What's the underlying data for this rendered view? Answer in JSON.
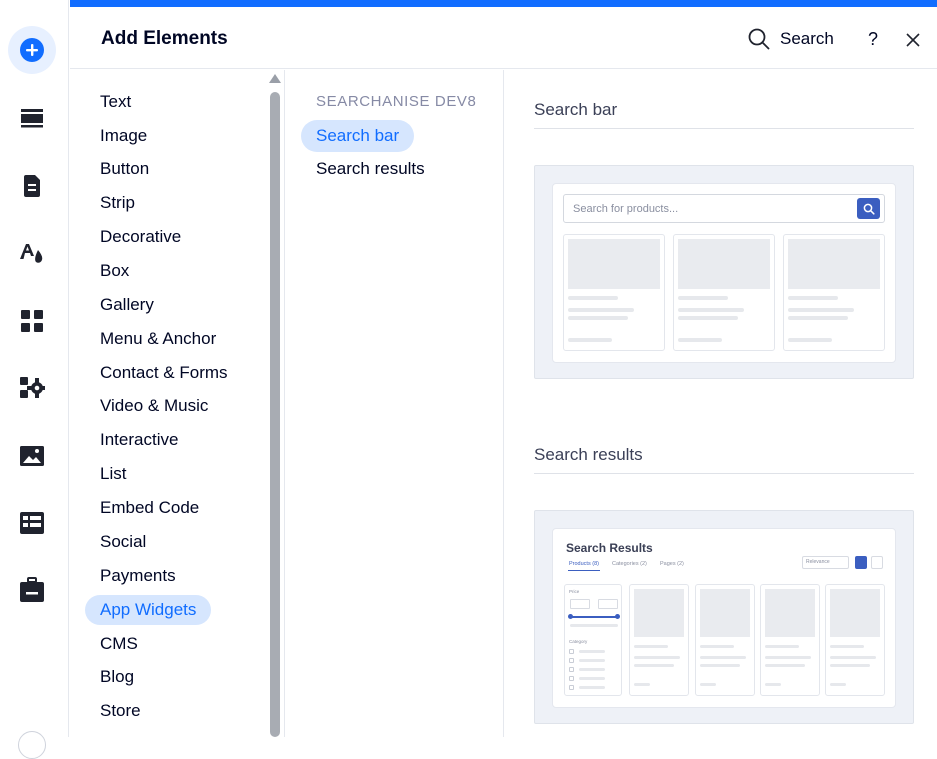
{
  "rail": {
    "items": [
      {
        "name": "add-elements-icon",
        "active": true
      },
      {
        "name": "sections-icon",
        "active": false
      },
      {
        "name": "pages-icon",
        "active": false
      },
      {
        "name": "theme-design-icon",
        "active": false
      },
      {
        "name": "app-market-icon",
        "active": false
      },
      {
        "name": "business-apps-icon",
        "active": false
      },
      {
        "name": "media-icon",
        "active": false
      },
      {
        "name": "cms-table-icon",
        "active": false
      },
      {
        "name": "portfolio-briefcase-icon",
        "active": false
      }
    ]
  },
  "header": {
    "title": "Add Elements",
    "search_label": "Search",
    "help_label": "?"
  },
  "categories": {
    "items": [
      "Text",
      "Image",
      "Button",
      "Strip",
      "Decorative",
      "Box",
      "Gallery",
      "Menu & Anchor",
      "Contact & Forms",
      "Video & Music",
      "Interactive",
      "List",
      "Embed Code",
      "Social",
      "Payments",
      "App Widgets",
      "CMS",
      "Blog",
      "Store"
    ],
    "selected": "App Widgets"
  },
  "subcategories": {
    "heading": "SEARCHANISE DEV8",
    "items": [
      "Search bar",
      "Search results"
    ],
    "selected": "Search bar"
  },
  "previews": {
    "search_bar": {
      "title": "Search bar",
      "placeholder": "Search for products..."
    },
    "search_results": {
      "title": "Search results",
      "widget_title": "Search Results",
      "tabs": [
        "Products (8)",
        "Categories (2)",
        "Pages (2)"
      ],
      "sort_label": "Relevance",
      "filter_price": "Price",
      "filter_category": "Category"
    }
  },
  "colors": {
    "accent": "#116dff",
    "selected_bg": "#d6e6fe",
    "widget_button": "#3b5ec0"
  }
}
